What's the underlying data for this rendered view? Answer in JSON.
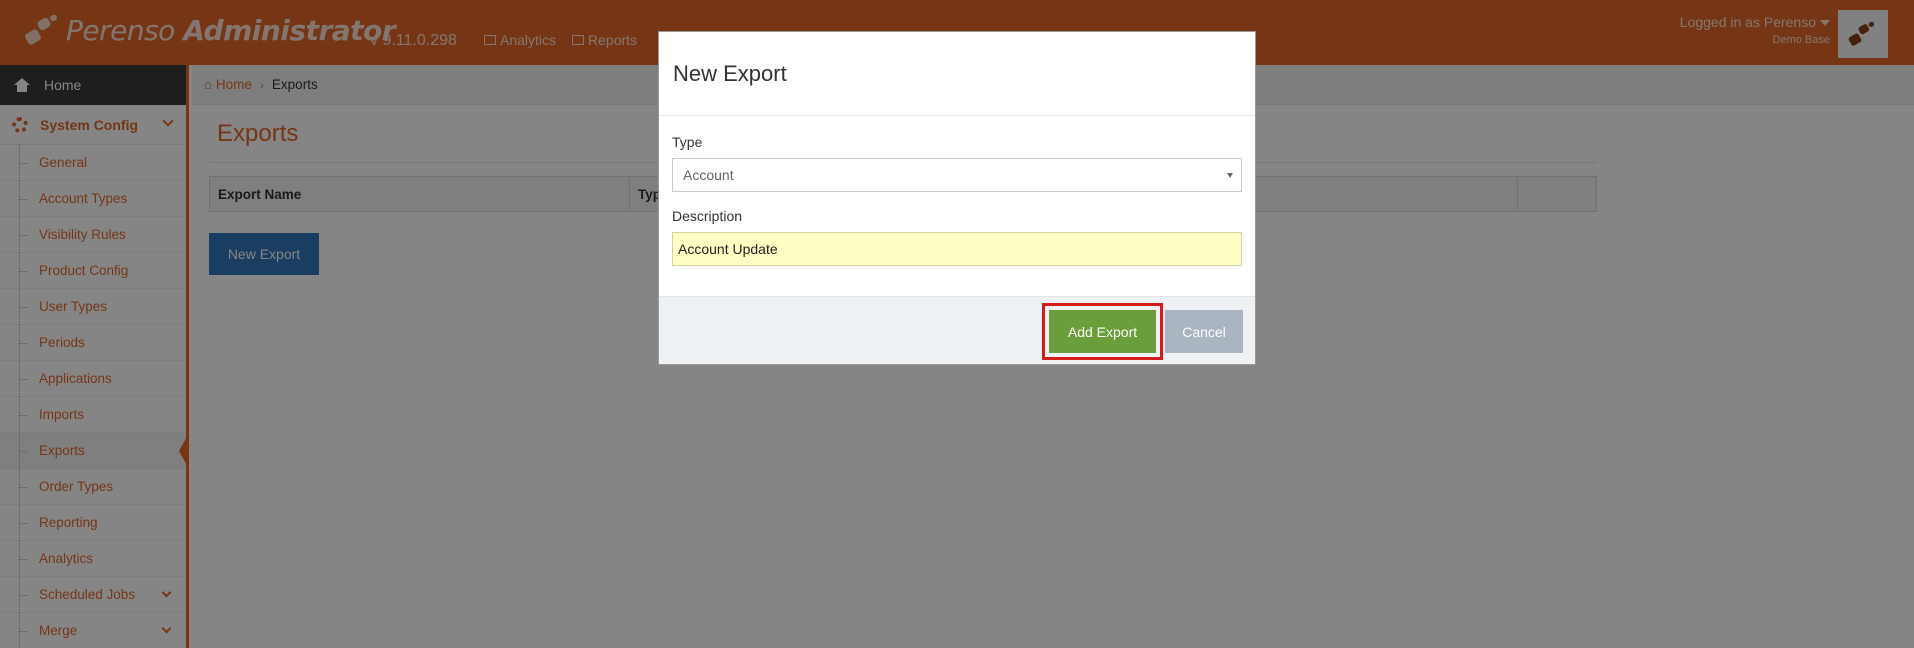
{
  "app": {
    "brand_light": "Perenso",
    "brand_bold": "Administrator",
    "version": "v 9.11.0.298",
    "nav": [
      {
        "label": "Analytics",
        "icon": "bar-chart-icon"
      },
      {
        "label": "Reports",
        "icon": "table-icon"
      }
    ],
    "user": {
      "logged_in": "Logged in as Perenso",
      "base": "Demo Base"
    },
    "colors": {
      "brand": "#e2682b",
      "primary": "#3377bb",
      "success": "#6a9e3a",
      "highlight": "#d31c1c"
    }
  },
  "sidebar": {
    "home": "Home",
    "section": "System Config",
    "items": [
      {
        "label": "General"
      },
      {
        "label": "Account Types"
      },
      {
        "label": "Visibility Rules"
      },
      {
        "label": "Product Config"
      },
      {
        "label": "User Types"
      },
      {
        "label": "Periods"
      },
      {
        "label": "Applications"
      },
      {
        "label": "Imports"
      },
      {
        "label": "Exports",
        "active": true
      },
      {
        "label": "Order Types"
      },
      {
        "label": "Reporting"
      },
      {
        "label": "Analytics"
      },
      {
        "label": "Scheduled Jobs",
        "expandable": true
      },
      {
        "label": "Merge",
        "expandable": true
      }
    ]
  },
  "breadcrumb": {
    "home": "Home",
    "current": "Exports"
  },
  "page": {
    "title": "Exports",
    "table_headers": [
      "Export Name",
      "Type",
      ""
    ],
    "new_button": "New Export"
  },
  "modal": {
    "title": "New Export",
    "type_label": "Type",
    "type_value": "Account",
    "description_label": "Description",
    "description_value": "Account Update",
    "add_button": "Add Export",
    "cancel_button": "Cancel"
  }
}
